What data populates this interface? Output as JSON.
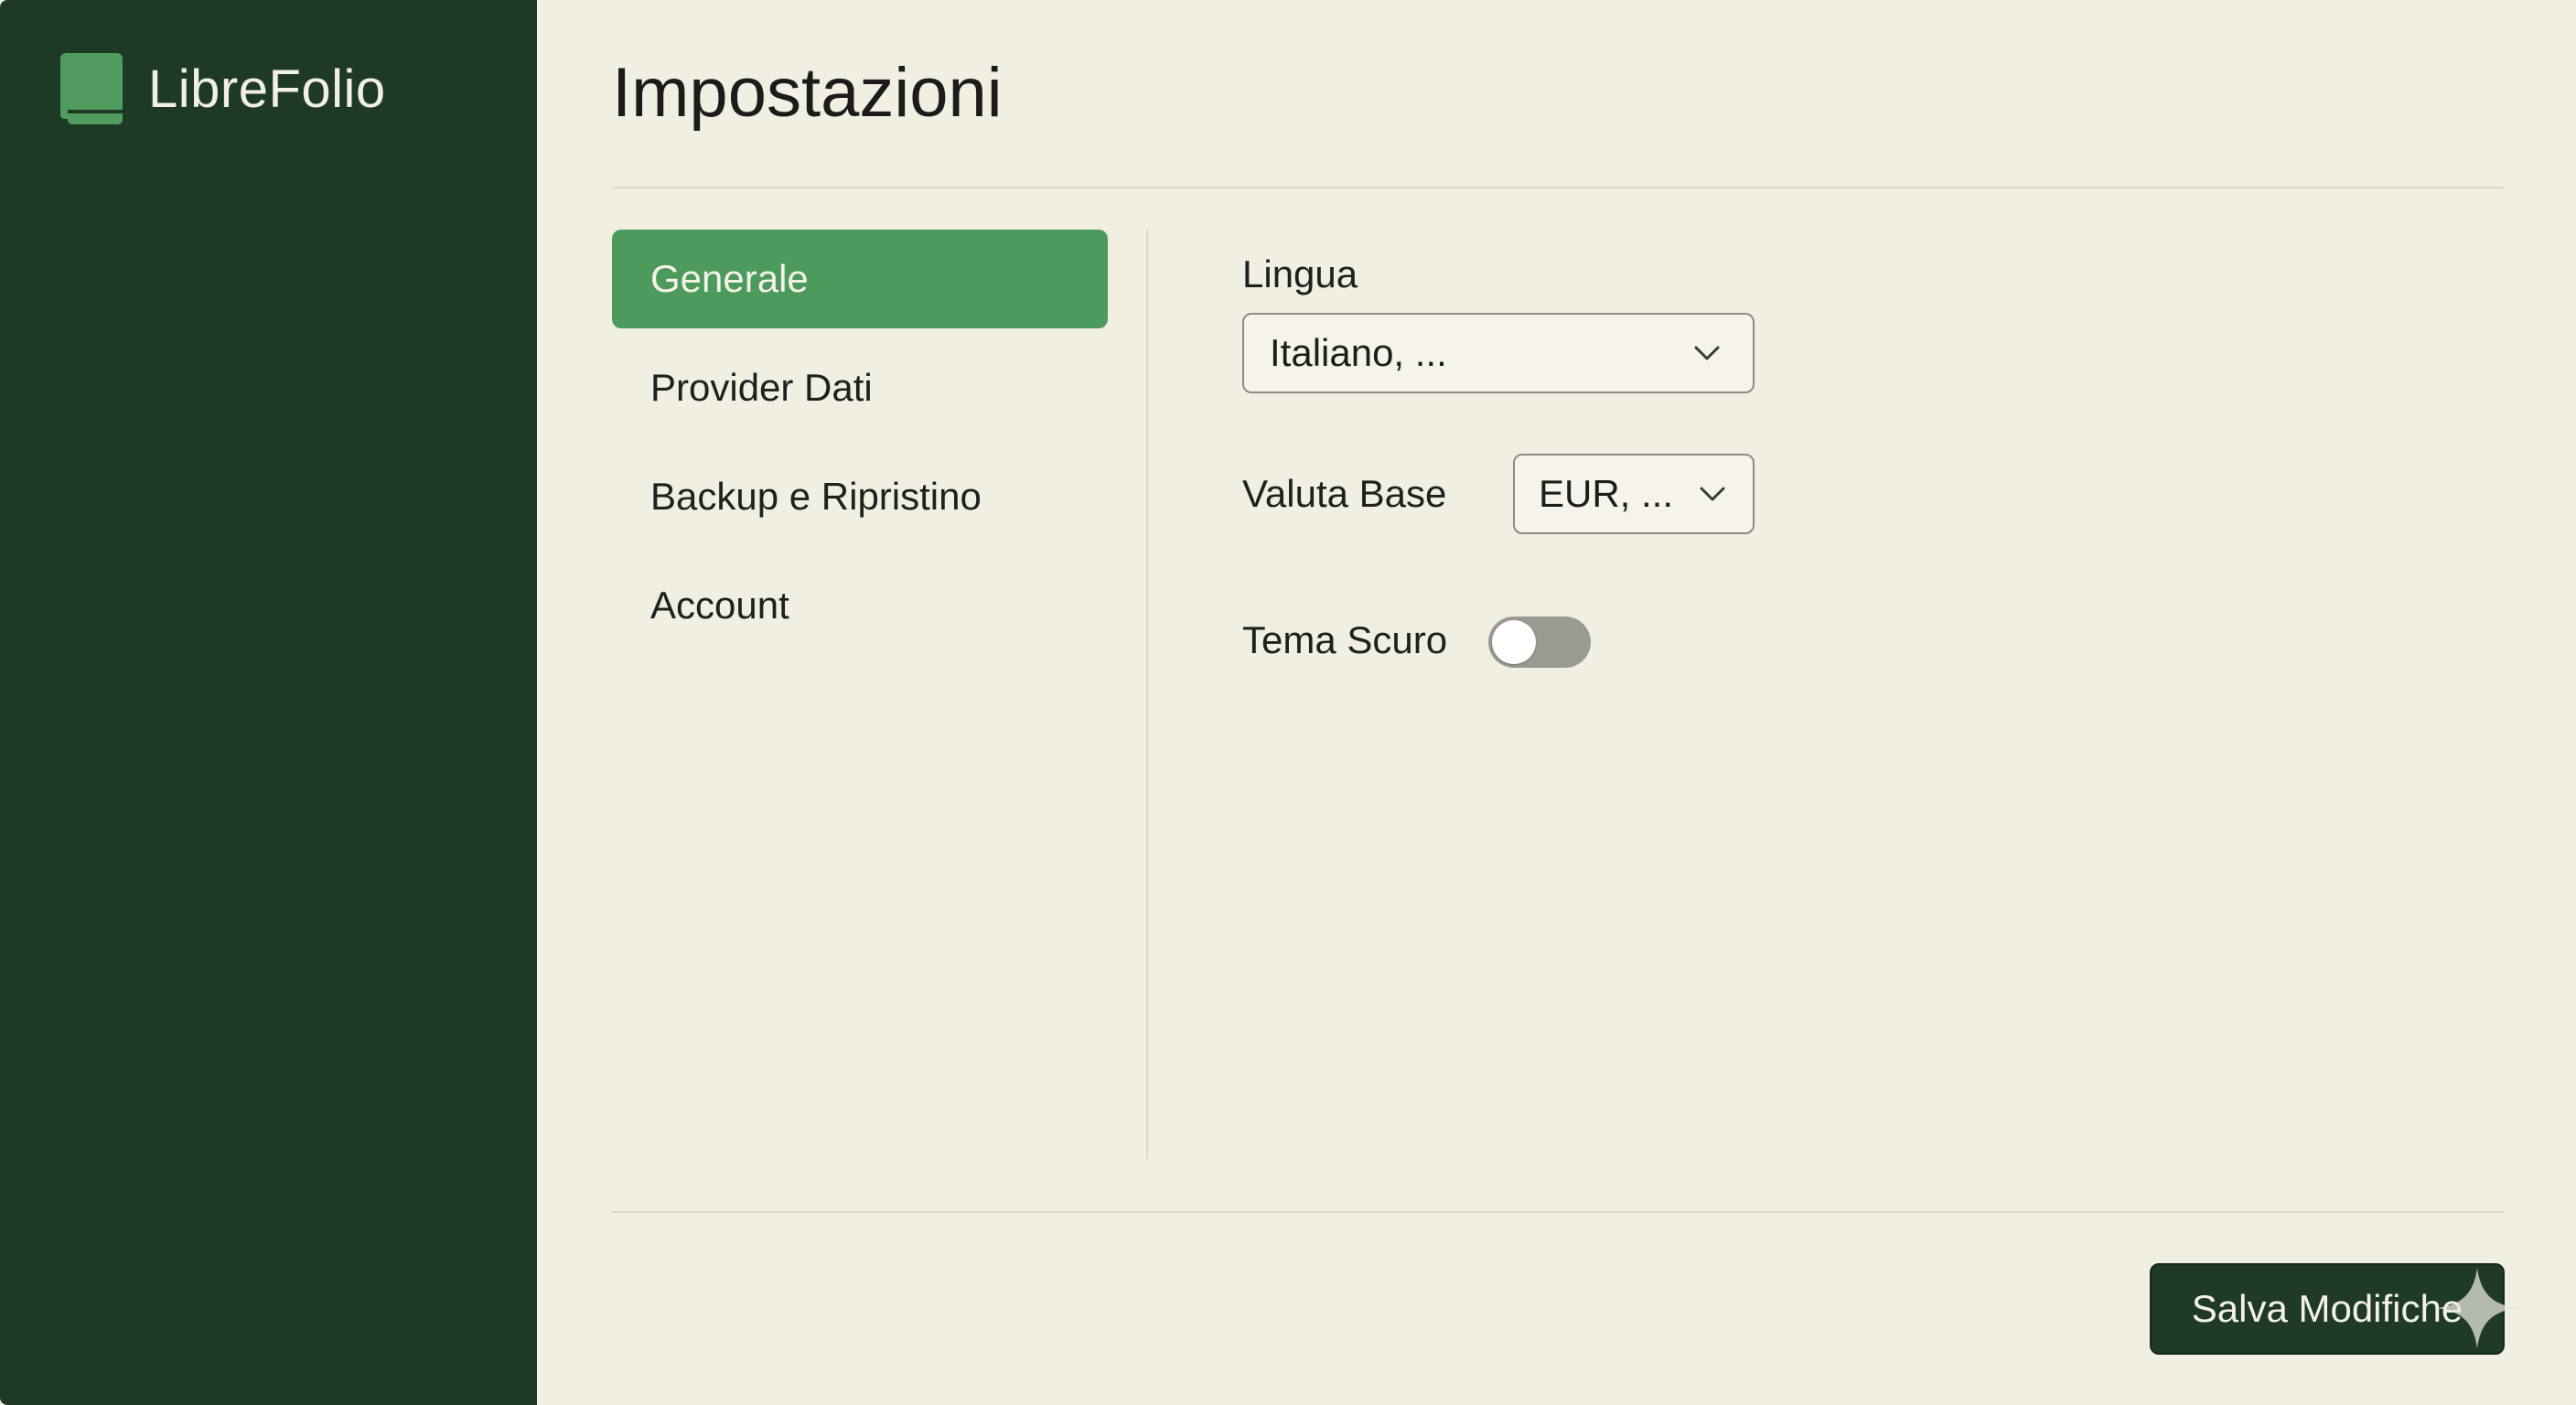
{
  "app": {
    "name": "LibreFolio",
    "logo_icon": "book-icon",
    "accent_color": "#4d9a5d",
    "sidebar_color": "#1e3a27"
  },
  "page": {
    "title": "Impostazioni"
  },
  "settings_nav": {
    "items": [
      {
        "label": "Generale",
        "active": true
      },
      {
        "label": "Provider Dati",
        "active": false
      },
      {
        "label": "Backup e Ripristino",
        "active": false
      },
      {
        "label": "Account",
        "active": false
      }
    ]
  },
  "general": {
    "language_label": "Lingua",
    "language_value": "Italiano, ...",
    "base_currency_label": "Valuta Base",
    "base_currency_value": "EUR, ...",
    "dark_theme_label": "Tema Scuro",
    "dark_theme_enabled": false
  },
  "footer": {
    "save_label": "Salva Modifiche"
  },
  "icons": {
    "dropdown": "chevron-down-icon",
    "watermark": "sparkle-icon"
  }
}
